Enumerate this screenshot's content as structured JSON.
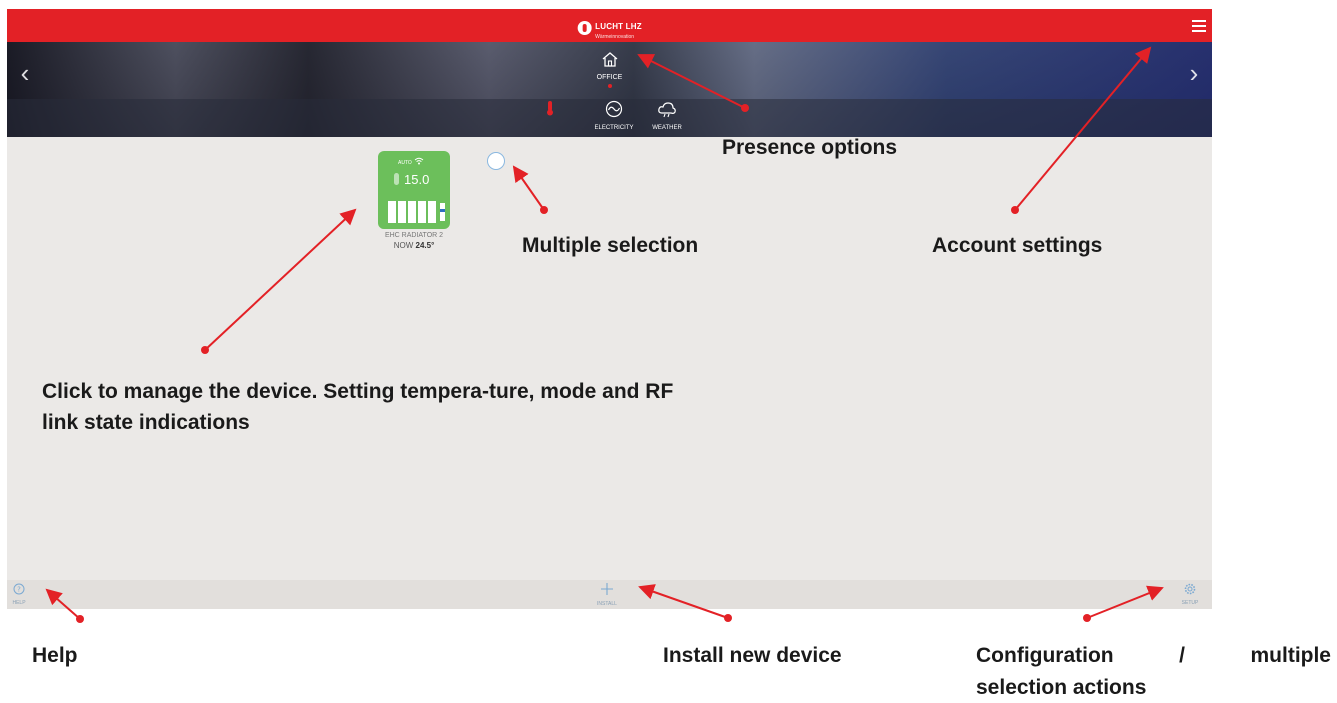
{
  "header": {
    "logo_text": "LUCHT LHZ",
    "logo_sub": "Wärmeinnovation",
    "menu_icon": "hamburger-menu-icon",
    "brand_color": "#e32126"
  },
  "hero": {
    "presence_label": "OFFICE",
    "tabs": [
      {
        "label": "",
        "icon": "thermometer-icon"
      },
      {
        "label": "ELECTRICITY",
        "icon": "electricity-icon"
      },
      {
        "label": "WEATHER",
        "icon": "weather-icon"
      }
    ]
  },
  "device": {
    "mode": "AUTO",
    "set_temp": "15.0",
    "name": "EHC RADIATOR 2",
    "now_prefix": "NOW",
    "now_temp": "24.5°",
    "tile_color": "#6cbf5b"
  },
  "bottom": {
    "help_label": "HELP",
    "install_label": "INSTALL",
    "setup_label": "SETUP"
  },
  "annotations": {
    "presence": "Presence options",
    "multi": "Multiple selection",
    "account": "Account settings",
    "device": "Click to manage the device. Setting tempera-ture, mode and RF link state indications",
    "help": "Help",
    "install": "Install new device",
    "config_line1": "Configuration / multiple",
    "config_line2": "selection actions",
    "arrow_color": "#e32126"
  }
}
